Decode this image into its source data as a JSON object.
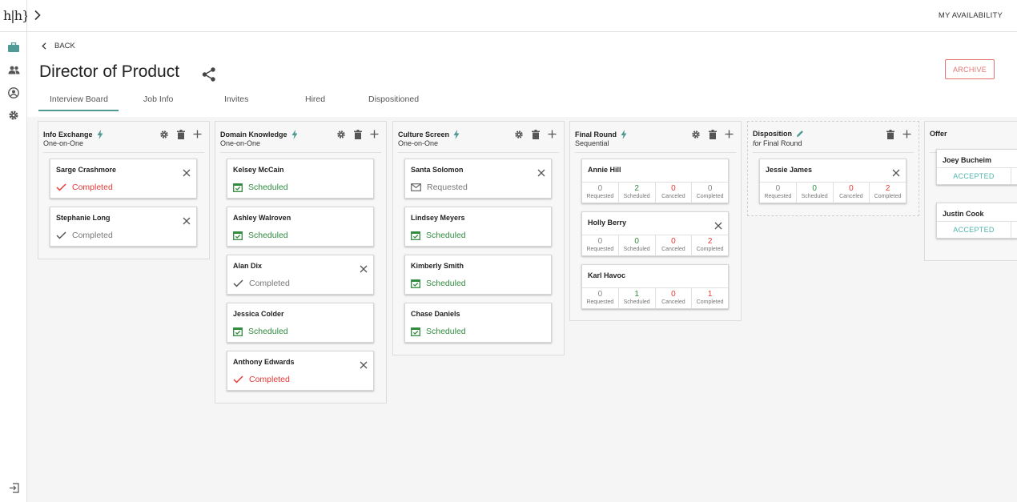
{
  "app": {
    "logo_text": "h|h}",
    "availability_label": "MY AVAILABILITY",
    "back_label": "BACK",
    "page_title": "Director of Product",
    "archive_label": "ARCHIVE",
    "accent_color": "#4f9a94",
    "tabs": [
      {
        "label": "Interview Board",
        "active": true
      },
      {
        "label": "Job Info",
        "active": false
      },
      {
        "label": "Invites",
        "active": false
      },
      {
        "label": "Hired",
        "active": false
      },
      {
        "label": "Dispositioned",
        "active": false
      }
    ],
    "sidebar_icons": [
      "briefcase-icon",
      "people-icon",
      "account-icon",
      "gear-icon",
      "logout-icon"
    ]
  },
  "columns": {
    "info_exchange": {
      "title": "Info Exchange",
      "subtitle": "One-on-One",
      "cards": [
        {
          "name": "Sarge Crashmore",
          "status": "Completed",
          "status_color": "red"
        },
        {
          "name": "Stephanie Long",
          "status": "Completed",
          "status_color": "grey"
        }
      ]
    },
    "domain_knowledge": {
      "title": "Domain Knowledge",
      "subtitle": "One-on-One",
      "cards": [
        {
          "name": "Kelsey McCain",
          "status": "Scheduled",
          "status_color": "green"
        },
        {
          "name": "Ashley Walroven",
          "status": "Scheduled",
          "status_color": "green"
        },
        {
          "name": "Alan Dix",
          "status": "Completed",
          "status_color": "grey"
        },
        {
          "name": "Jessica Colder",
          "status": "Scheduled",
          "status_color": "green"
        },
        {
          "name": "Anthony Edwards",
          "status": "Completed",
          "status_color": "red"
        }
      ]
    },
    "culture_screen": {
      "title": "Culture Screen",
      "subtitle": "One-on-One",
      "cards": [
        {
          "name": "Santa Solomon",
          "status": "Requested",
          "status_color": "grey"
        },
        {
          "name": "Lindsey Meyers",
          "status": "Scheduled",
          "status_color": "green"
        },
        {
          "name": "Kimberly Smith",
          "status": "Scheduled",
          "status_color": "green"
        },
        {
          "name": "Chase Daniels",
          "status": "Scheduled",
          "status_color": "green"
        }
      ]
    },
    "final_round": {
      "title": "Final Round",
      "subtitle": "Sequential",
      "stat_labels": [
        "Requested",
        "Scheduled",
        "Canceled",
        "Completed"
      ],
      "cards": [
        {
          "name": "Annie Hill",
          "stats": [
            "0",
            "2",
            "0",
            "0"
          ]
        },
        {
          "name": "Holly Berry",
          "stats": [
            "0",
            "0",
            "0",
            "2"
          ]
        },
        {
          "name": "Karl Havoc",
          "stats": [
            "0",
            "1",
            "0",
            "1"
          ]
        }
      ]
    },
    "disposition": {
      "title": "Disposition",
      "subtitle_prefix": "for",
      "subtitle_target": "Final Round",
      "cards": [
        {
          "name": "Jessie James",
          "stats": [
            "0",
            "0",
            "0",
            "2"
          ]
        }
      ]
    },
    "offer": {
      "title": "Offer",
      "cards": [
        {
          "name": "Joey Bucheim",
          "status": "ACCEPTED"
        },
        {
          "name": "Justin Cook",
          "status": "ACCEPTED"
        }
      ]
    }
  }
}
